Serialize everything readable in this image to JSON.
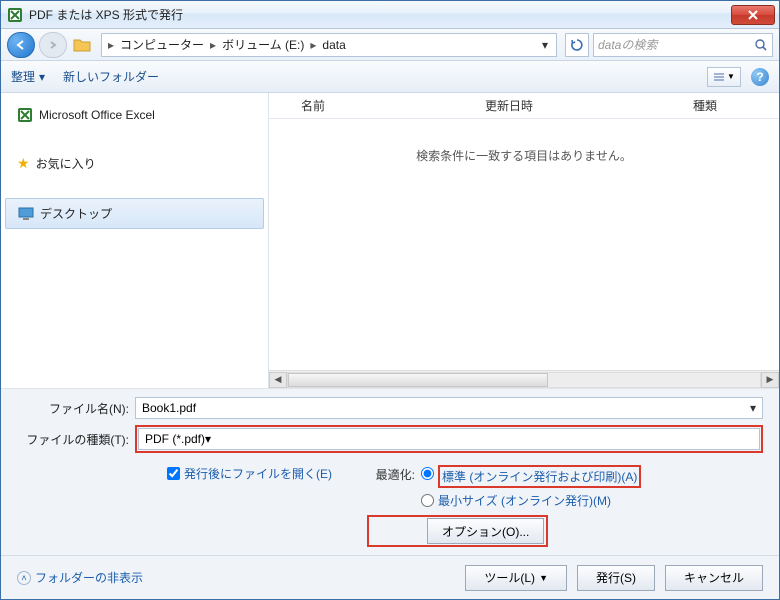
{
  "window": {
    "title": "PDF または XPS 形式で発行"
  },
  "breadcrumb": [
    "コンピューター",
    "ボリューム (E:)",
    "data"
  ],
  "search": {
    "placeholder": "dataの検索"
  },
  "toolbar": {
    "organize": "整理",
    "new_folder": "新しいフォルダー"
  },
  "sidebar": {
    "items": [
      {
        "label": "Microsoft Office Excel"
      },
      {
        "label": "お気に入り"
      },
      {
        "label": "デスクトップ"
      }
    ]
  },
  "columns": {
    "name": "名前",
    "modified": "更新日時",
    "type": "種類"
  },
  "empty_message": "検索条件に一致する項目はありません。",
  "filename": {
    "label": "ファイル名(N):",
    "value": "Book1.pdf"
  },
  "filetype": {
    "label": "ファイルの種類(T):",
    "value": "PDF (*.pdf)"
  },
  "open_after": {
    "label": "発行後にファイルを開く(E)"
  },
  "optimize": {
    "label": "最適化:",
    "standard": "標準 (オンライン発行および印刷)(A)",
    "minimum": "最小サイズ (オンライン発行)(M)"
  },
  "options_button": "オプション(O)...",
  "footer": {
    "hide_folders": "フォルダーの非表示",
    "tools": "ツール(L)",
    "publish": "発行(S)",
    "cancel": "キャンセル"
  }
}
